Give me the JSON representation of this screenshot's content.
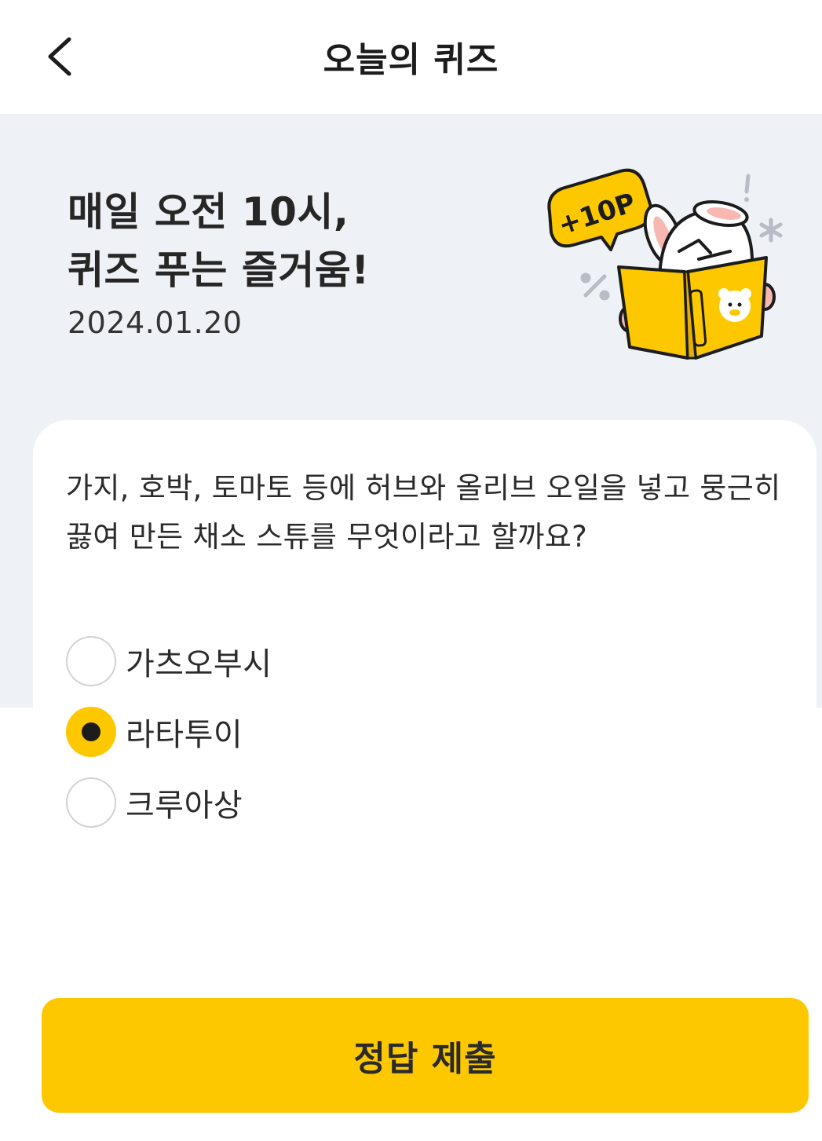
{
  "header": {
    "title": "오늘의 퀴즈",
    "back_icon": "chevron-left-icon"
  },
  "hero": {
    "headline_line1": "매일 오전 10시,",
    "headline_line2": "퀴즈 푸는 즐거움!",
    "date": "2024.01.20",
    "badge_text": "+10P"
  },
  "quiz": {
    "question": "가지, 호박, 토마토 등에 허브와 올리브 오일을 넣고 뭉근히 끓여 만든 채소 스튜를 무엇이라고 할까요?",
    "options": [
      {
        "label": "가츠오부시",
        "selected": false
      },
      {
        "label": "라타투이",
        "selected": true
      },
      {
        "label": "크루아상",
        "selected": false
      }
    ]
  },
  "submit": {
    "label": "정답 제출"
  },
  "colors": {
    "accent": "#fdc800",
    "hero_bg": "#eef1f6",
    "text": "#222222"
  }
}
